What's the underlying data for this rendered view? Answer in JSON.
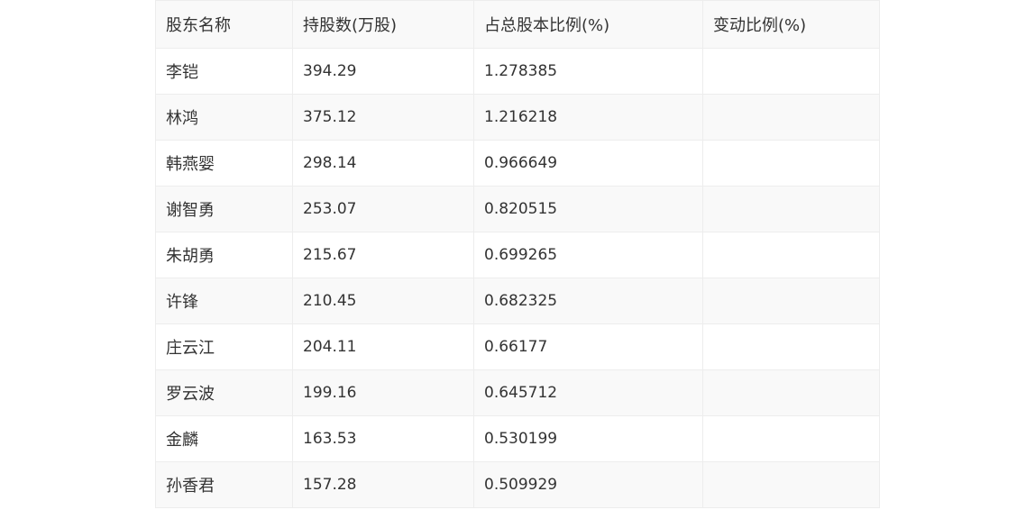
{
  "table": {
    "headers": [
      "股东名称",
      "持股数(万股)",
      "占总股本比例(%)",
      "变动比例(%)"
    ],
    "rows": [
      [
        "李铠",
        "394.29",
        "1.278385",
        ""
      ],
      [
        "林鸿",
        "375.12",
        "1.216218",
        ""
      ],
      [
        "韩燕婴",
        "298.14",
        "0.966649",
        ""
      ],
      [
        "谢智勇",
        "253.07",
        "0.820515",
        ""
      ],
      [
        "朱胡勇",
        "215.67",
        "0.699265",
        ""
      ],
      [
        "许锋",
        "210.45",
        "0.682325",
        ""
      ],
      [
        "庄云江",
        "204.11",
        "0.66177",
        ""
      ],
      [
        "罗云波",
        "199.16",
        "0.645712",
        ""
      ],
      [
        "金麟",
        "163.53",
        "0.530199",
        ""
      ],
      [
        "孙香君",
        "157.28",
        "0.509929",
        ""
      ]
    ]
  }
}
